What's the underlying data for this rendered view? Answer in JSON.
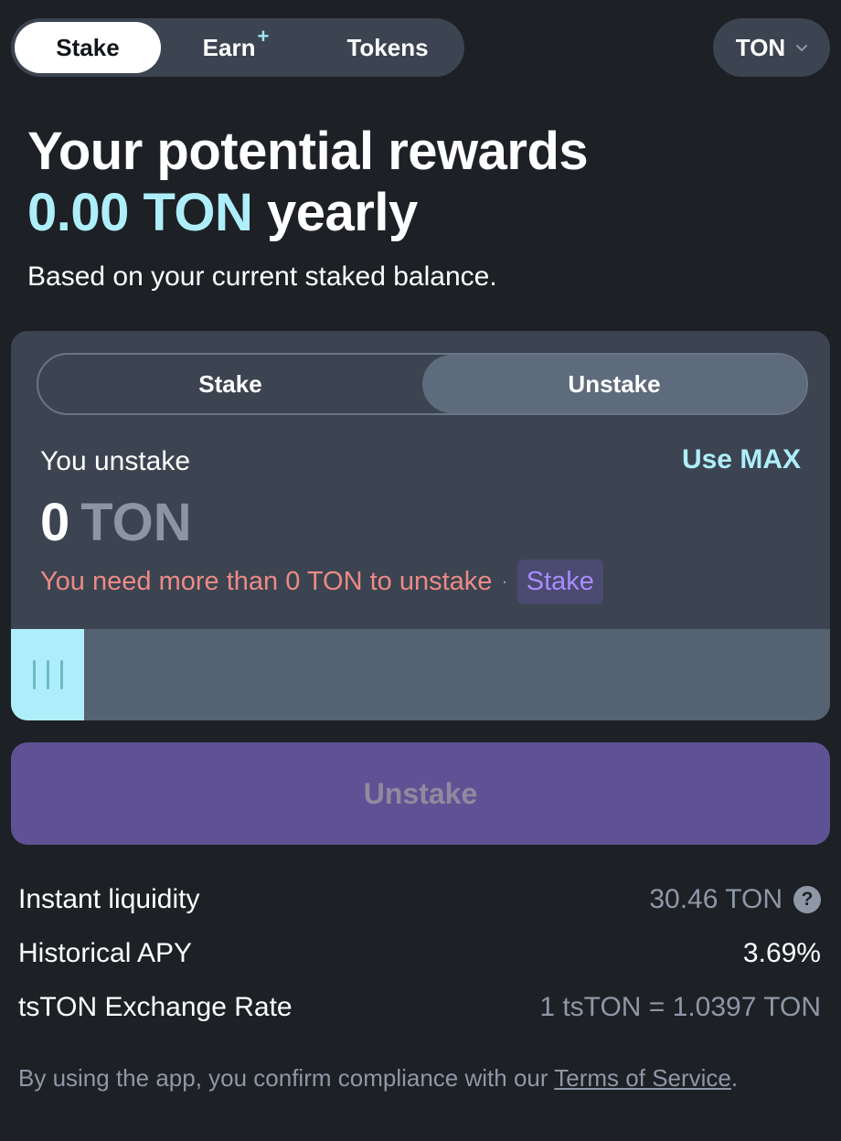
{
  "nav": {
    "tabs": [
      {
        "label": "Stake"
      },
      {
        "label": "Earn",
        "badge": "+"
      },
      {
        "label": "Tokens"
      }
    ],
    "asset": "TON",
    "asset_icon": "chevron-down-icon"
  },
  "hero": {
    "title_line1": "Your potential rewards",
    "amount": "0.00 TON",
    "period": "yearly",
    "subtitle": "Based on your current staked balance."
  },
  "card": {
    "segments": {
      "stake": "Stake",
      "unstake": "Unstake",
      "active": "unstake"
    },
    "input_label": "You unstake",
    "use_max": "Use MAX",
    "amount_value": "0",
    "amount_unit": "TON",
    "warning": "You need more than 0 TON to unstake",
    "separator": "·",
    "warning_link": "Stake",
    "slider_value_percent": 0
  },
  "primary_button": "Unstake",
  "info": [
    {
      "label": "Instant liquidity",
      "value": "30.46 TON"
    },
    {
      "label": "Historical APY",
      "value": "3.69%"
    },
    {
      "label": "tsTON Exchange Rate",
      "value": "1 tsTON = 1.0397 TON"
    }
  ],
  "footer": {
    "text": "By using the app, you confirm compliance with our",
    "link": "Terms of Service",
    "end": "."
  },
  "colors": {
    "background": "#1d2025",
    "card": "#3b4450",
    "accent": "#aeeefa",
    "button": "#5f5294",
    "error": "#ec8a85",
    "link": "#a88cff"
  }
}
